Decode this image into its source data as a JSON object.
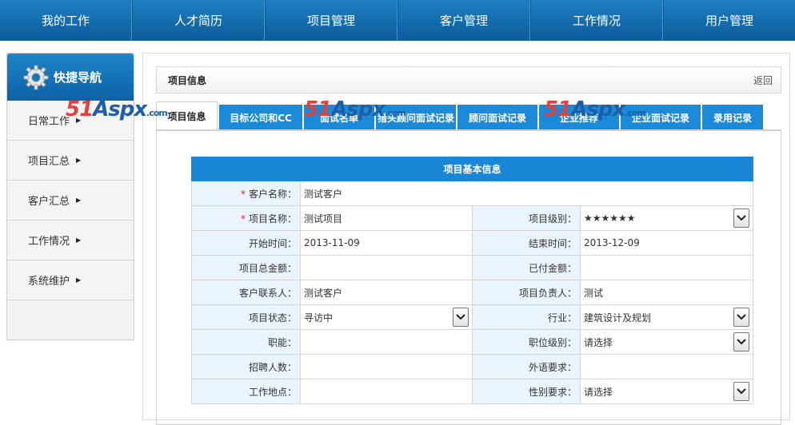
{
  "topnav": [
    "我的工作",
    "人才简历",
    "项目管理",
    "客户管理",
    "工作情况",
    "用户管理"
  ],
  "sidebar": {
    "title": "快捷导航",
    "items": [
      {
        "label": "日常工作"
      },
      {
        "label": "项目汇总"
      },
      {
        "label": "客户汇总"
      },
      {
        "label": "工作情况"
      },
      {
        "label": "系统维护"
      }
    ]
  },
  "infobar": {
    "title": "项目信息",
    "back": "返回"
  },
  "tabs": [
    {
      "label": "项目信息",
      "active": true
    },
    {
      "label": "目标公司和CC"
    },
    {
      "label": "面试名单"
    },
    {
      "label": "猎头顾问面试记录"
    },
    {
      "label": "顾问面试记录"
    },
    {
      "label": "企业推荐"
    },
    {
      "label": "企业面试记录"
    },
    {
      "label": "录用记录"
    }
  ],
  "watermark": {
    "num": "51",
    "brand": "Aspx",
    "suffix": ".com"
  },
  "form": {
    "caption": "项目基本信息",
    "customer_label": "客户名称：",
    "customer_value": "测试客户",
    "project_label": "项目名称：",
    "project_value": "测试项目",
    "level_label": "项目级别：",
    "level_value": "★★★★★★",
    "start_label": "开始时间：",
    "start_value": "2013-11-09",
    "end_label": "结束时间：",
    "end_value": "2013-12-09",
    "total_label": "项目总金额：",
    "total_value": "",
    "paid_label": "已付金额：",
    "paid_value": "",
    "contact_label": "客户联系人：",
    "contact_value": "测试客户",
    "manager_label": "项目负责人：",
    "manager_value": "测试",
    "status_label": "项目状态：",
    "status_value": "寻访中",
    "industry_label": "行业：",
    "industry_value": "建筑设计及规划",
    "function_label": "职能：",
    "function_value": "",
    "grade_label": "职位级别：",
    "grade_value": "请选择",
    "headcount_label": "招聘人数：",
    "headcount_value": "",
    "language_label": "外语要求：",
    "language_value": "",
    "location_label": "工作地点：",
    "location_value": "",
    "gender_label": "性别要求：",
    "gender_value": "请选择"
  }
}
